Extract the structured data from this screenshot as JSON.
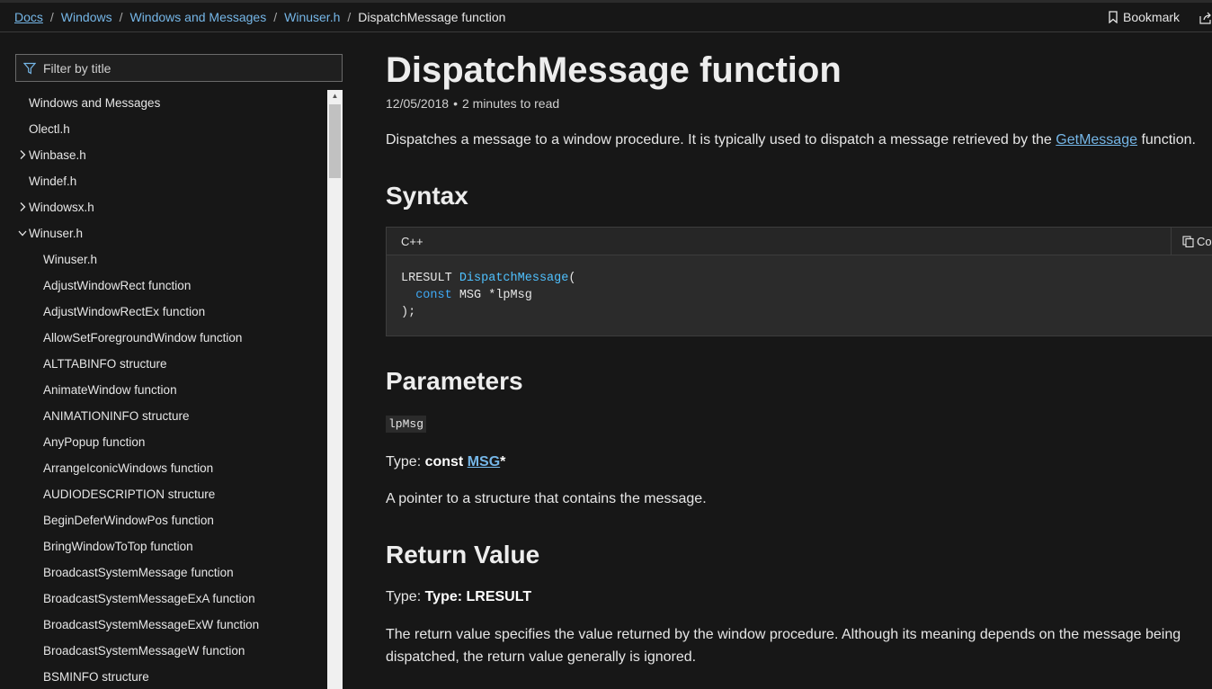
{
  "breadcrumb": {
    "items": [
      "Docs",
      "Windows",
      "Windows and Messages",
      "Winuser.h"
    ],
    "current": "DispatchMessage function",
    "separator": "/"
  },
  "header": {
    "bookmark_label": "Bookmark",
    "bookmark_icon": "bookmark-icon",
    "share_icon": "share-icon"
  },
  "sidebar": {
    "filter_placeholder": "Filter by title",
    "filter_icon": "filter-icon",
    "items": [
      {
        "label": "Windows and Messages",
        "level": 0,
        "expander": "none"
      },
      {
        "label": "Olectl.h",
        "level": 0,
        "expander": "none"
      },
      {
        "label": "Winbase.h",
        "level": 0,
        "expander": "collapsed"
      },
      {
        "label": "Windef.h",
        "level": 0,
        "expander": "none"
      },
      {
        "label": "Windowsx.h",
        "level": 0,
        "expander": "collapsed"
      },
      {
        "label": "Winuser.h",
        "level": 0,
        "expander": "expanded"
      },
      {
        "label": "Winuser.h",
        "level": 1,
        "expander": "none"
      },
      {
        "label": "AdjustWindowRect function",
        "level": 1,
        "expander": "none"
      },
      {
        "label": "AdjustWindowRectEx function",
        "level": 1,
        "expander": "none"
      },
      {
        "label": "AllowSetForegroundWindow function",
        "level": 1,
        "expander": "none"
      },
      {
        "label": "ALTTABINFO structure",
        "level": 1,
        "expander": "none"
      },
      {
        "label": "AnimateWindow function",
        "level": 1,
        "expander": "none"
      },
      {
        "label": "ANIMATIONINFO structure",
        "level": 1,
        "expander": "none"
      },
      {
        "label": "AnyPopup function",
        "level": 1,
        "expander": "none"
      },
      {
        "label": "ArrangeIconicWindows function",
        "level": 1,
        "expander": "none"
      },
      {
        "label": "AUDIODESCRIPTION structure",
        "level": 1,
        "expander": "none"
      },
      {
        "label": "BeginDeferWindowPos function",
        "level": 1,
        "expander": "none"
      },
      {
        "label": "BringWindowToTop function",
        "level": 1,
        "expander": "none"
      },
      {
        "label": "BroadcastSystemMessage function",
        "level": 1,
        "expander": "none"
      },
      {
        "label": "BroadcastSystemMessageExA function",
        "level": 1,
        "expander": "none"
      },
      {
        "label": "BroadcastSystemMessageExW function",
        "level": 1,
        "expander": "none"
      },
      {
        "label": "BroadcastSystemMessageW function",
        "level": 1,
        "expander": "none"
      },
      {
        "label": "BSMINFO structure",
        "level": 1,
        "expander": "none"
      }
    ]
  },
  "main": {
    "title": "DispatchMessage function",
    "date": "12/05/2018",
    "meta_separator": "•",
    "read_time": "2 minutes to read",
    "summary_before": "Dispatches a message to a window procedure. It is typically used to dispatch a message retrieved by the ",
    "summary_link": "GetMessage",
    "summary_after": " function.",
    "syntax_heading": "Syntax",
    "code": {
      "language": "C++",
      "copy_label": "Copy",
      "copy_icon": "copy-icon",
      "line1_type": "LRESULT",
      "line1_fn": "DispatchMessage",
      "line1_paren": "(",
      "line2_kw": "const",
      "line2_rest": " MSG *lpMsg",
      "line3": ");"
    },
    "parameters_heading": "Parameters",
    "param_name": "lpMsg",
    "param_type_label": "Type: ",
    "param_type_const": "const ",
    "param_type_link": "MSG",
    "param_type_star": "*",
    "param_desc": "A pointer to a structure that contains the message.",
    "return_heading": "Return Value",
    "return_type_label": "Type: ",
    "return_type_value": "Type: LRESULT",
    "return_desc": "The return value specifies the value returned by the window procedure. Although its meaning depends on the message being dispatched, the return value generally is ignored."
  },
  "colors": {
    "background": "#171717",
    "link": "#75b6e7",
    "code_background": "#2b2b2b",
    "keyword": "#3fa9f5"
  }
}
